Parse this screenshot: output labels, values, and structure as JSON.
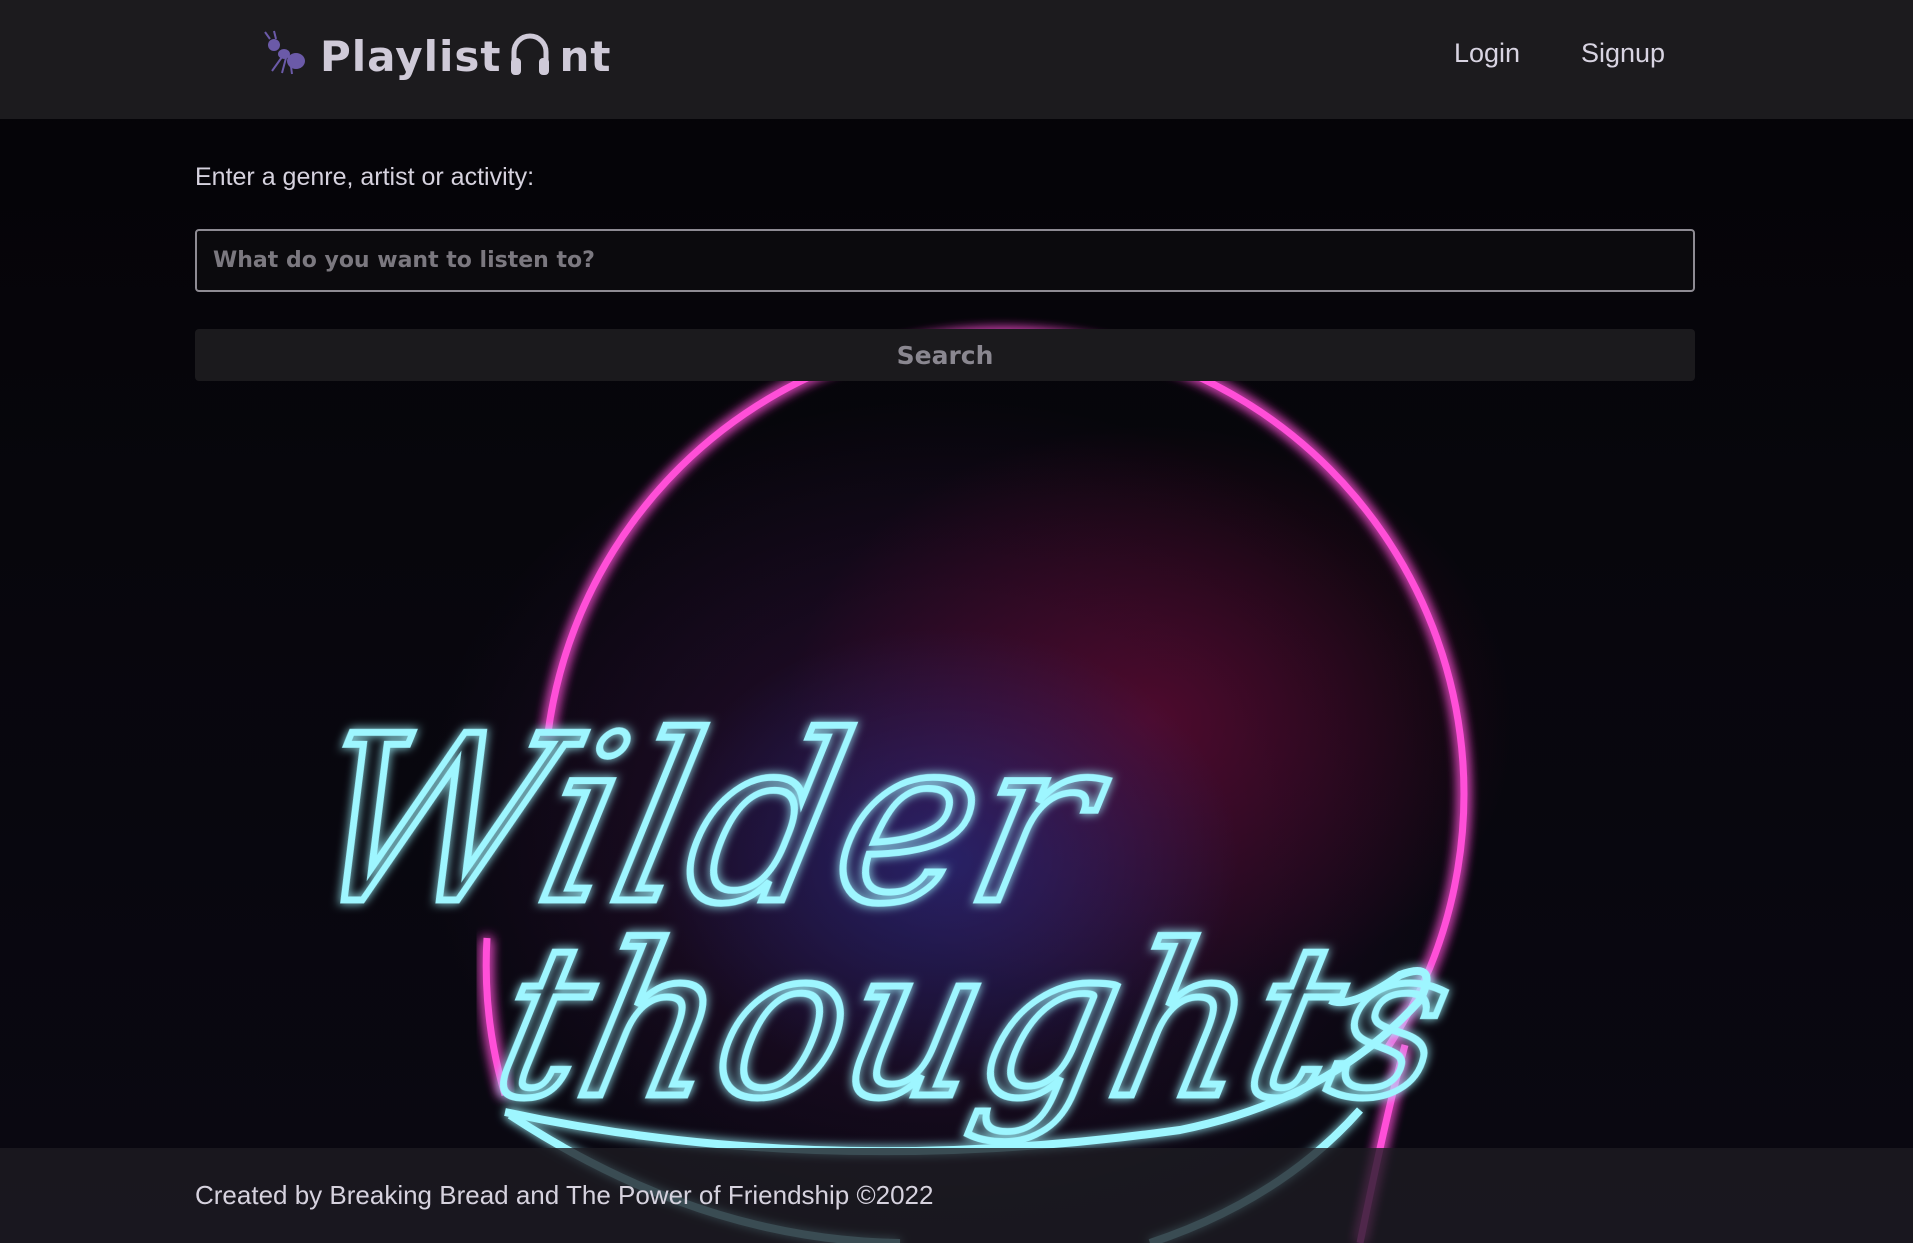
{
  "app": {
    "brand_prefix": "Playlist",
    "brand_suffix": "nt",
    "logo_icon": "ant-icon",
    "headphones_icon": "headphones-icon"
  },
  "nav": {
    "login_label": "Login",
    "signup_label": "Signup"
  },
  "search": {
    "label": "Enter a genre, artist or activity:",
    "placeholder": "What do you want to listen to?",
    "value": "",
    "button_label": "Search"
  },
  "background": {
    "neon_sign_line1": "Wilder",
    "neon_sign_line2": "thoughts",
    "colors": {
      "neon_pink": "#ff4fd8",
      "neon_cyan": "#9ef6ff"
    }
  },
  "footer": {
    "text": "Created by Breaking Bread and The Power of Friendship ©2022"
  },
  "colors": {
    "navbar_bg": "#1c1b1e",
    "text": "#d6d2de",
    "logo_ant": "#6b5aa8"
  }
}
